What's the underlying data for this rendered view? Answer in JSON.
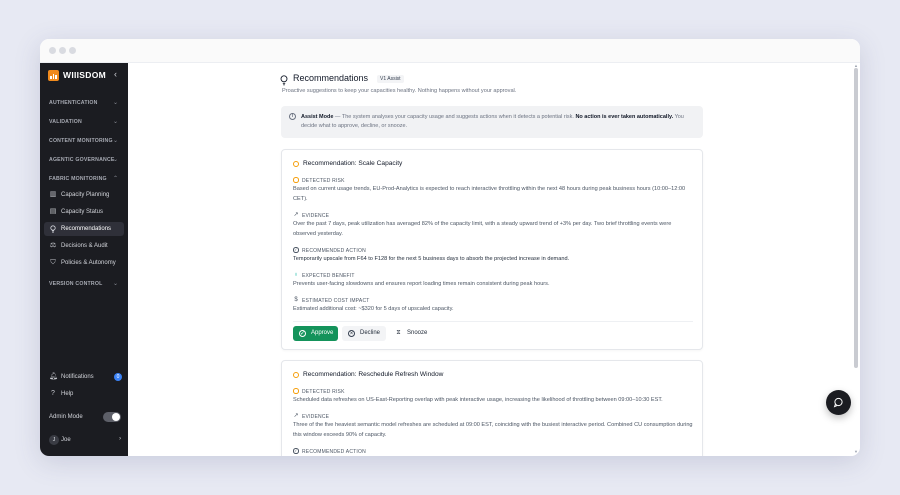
{
  "app": {
    "brand": "WIIISDOM"
  },
  "sidebar": {
    "sections": [
      {
        "label": "AUTHENTICATION"
      },
      {
        "label": "VALIDATION"
      },
      {
        "label": "CONTENT MONITORING"
      },
      {
        "label": "AGENTIC GOVERNANCE"
      },
      {
        "label": "FABRIC MONITORING"
      }
    ],
    "items": [
      {
        "label": "Capacity Planning",
        "icon": "bar-chart-icon"
      },
      {
        "label": "Capacity Status",
        "icon": "chart-icon"
      },
      {
        "label": "Recommendations",
        "icon": "lightbulb-icon",
        "active": true
      },
      {
        "label": "Decisions & Audit",
        "icon": "scales-icon"
      },
      {
        "label": "Policies & Autonomy",
        "icon": "shield-icon"
      }
    ],
    "version_control": "VERSION CONTROL",
    "notifications": {
      "label": "Notifications",
      "count": "0"
    },
    "help": "Help",
    "admin_mode": {
      "label": "Admin Mode",
      "enabled": true
    },
    "user": {
      "initial": "J",
      "name": "Joe"
    }
  },
  "page": {
    "title": "Recommendations",
    "version_badge": "V1 Assist",
    "subtitle": "Proactive suggestions to keep your capacities healthy. Nothing happens without your approval.",
    "notice": {
      "label": "Assist Mode",
      "text": " — The system analyses your capacity usage and suggests actions when it detects a potential risk. ",
      "bold": "No action is ever taken automatically.",
      "tail": " You decide what to approve, decline, or snooze."
    }
  },
  "cards": [
    {
      "title": "Recommendation: Scale Capacity",
      "risk_label": "DETECTED RISK",
      "risk": "Based on current usage trends, EU-Prod-Analytics is expected to reach interactive throttling within the next 48 hours during peak business hours (10:00–12:00 CET).",
      "evidence_label": "EVIDENCE",
      "evidence": "Over the past 7 days, peak utilization has averaged 82% of the capacity limit, with a steady upward trend of +3% per day. Two brief throttling events were observed yesterday.",
      "action_label": "RECOMMENDED ACTION",
      "action": "Temporarily upscale from F64 to F128 for the next 5 business days to absorb the projected increase in demand.",
      "benefit_label": "EXPECTED BENEFIT",
      "benefit": "Prevents user-facing slowdowns and ensures report loading times remain consistent during peak hours.",
      "cost_label": "ESTIMATED COST IMPACT",
      "cost": "Estimated additional cost: ~$320 for 5 days of upscaled capacity.",
      "buttons": {
        "approve": "Approve",
        "decline": "Decline",
        "snooze": "Snooze"
      }
    },
    {
      "title": "Recommendation: Reschedule Refresh Window",
      "risk_label": "DETECTED RISK",
      "risk": "Scheduled data refreshes on US-East-Reporting overlap with peak interactive usage, increasing the likelihood of throttling between 09:00–10:30 EST.",
      "evidence_label": "EVIDENCE",
      "evidence": "Three of the five heaviest semantic model refreshes are scheduled at 09:00 EST, coinciding with the busiest interactive period. Combined CU consumption during this window exceeds 90% of capacity.",
      "action_label": "RECOMMENDED ACTION"
    }
  ],
  "colors": {
    "sidebar_bg": "#1b1c21",
    "accent_green": "#14935b",
    "brand_orange": "#f08a1d",
    "warning_amber": "#f59e0b"
  }
}
